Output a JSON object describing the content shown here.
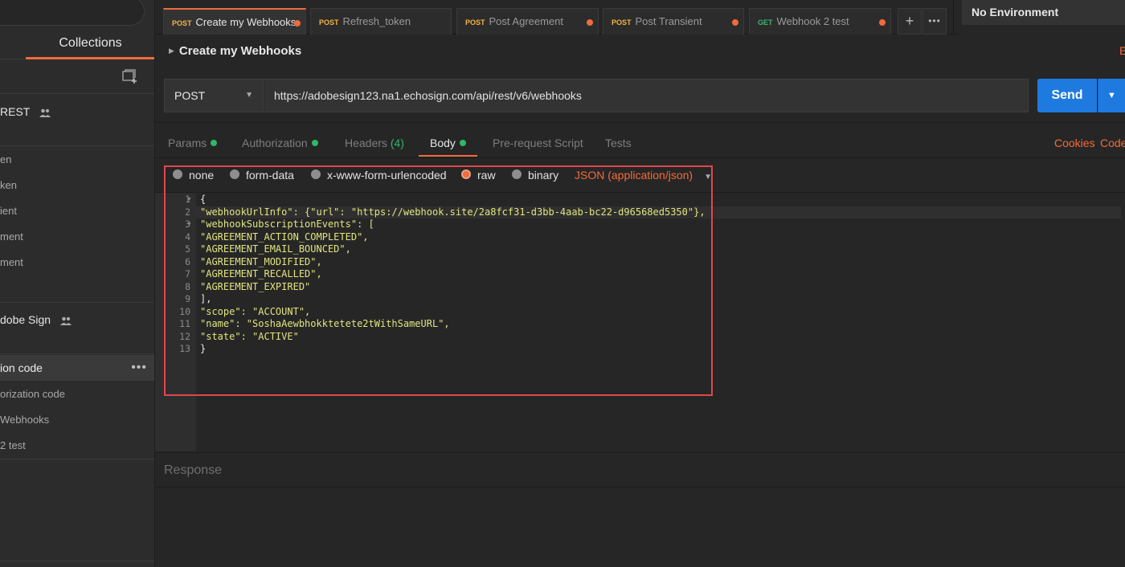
{
  "sidebar": {
    "tab_label": "Collections",
    "collections": [
      {
        "name": "REST"
      },
      {
        "name": "dobe Sign"
      }
    ],
    "items_group1": [
      "en",
      "ken",
      "ient",
      "ment",
      "ment"
    ],
    "items_group2": [
      {
        "label": "ion code",
        "active": true
      },
      {
        "label": "orization code",
        "active": false
      },
      {
        "label": "Webhooks",
        "active": false
      },
      {
        "label": "2 test",
        "active": false
      }
    ],
    "more_label": "•••"
  },
  "tabs": [
    {
      "method": "POST",
      "name": "Create my Webhooks",
      "active": true
    },
    {
      "method": "POST",
      "name": "Refresh_token",
      "active": false
    },
    {
      "method": "POST",
      "name": "Post Agreement",
      "active": false
    },
    {
      "method": "POST",
      "name": "Post Transient",
      "active": false
    },
    {
      "method": "GET",
      "name": "Webhook 2 test",
      "active": false
    }
  ],
  "tab_controls": {
    "add": "+",
    "more": "•••"
  },
  "environment": "No Environment",
  "request": {
    "name": "Create my Webhooks",
    "method": "POST",
    "url": "https://adobesign123.na1.echosign.com/api/rest/v6/webhooks",
    "send_label": "Send",
    "edge_label": "E"
  },
  "request_tabs": {
    "params": "Params",
    "authorization": "Authorization",
    "headers": "Headers",
    "headers_count": "(4)",
    "body": "Body",
    "prerequest": "Pre-request Script",
    "tests": "Tests"
  },
  "right_links": {
    "cookies": "Cookies",
    "code": "Code"
  },
  "body_types": {
    "none": "none",
    "form_data": "form-data",
    "urlencoded": "x-www-form-urlencoded",
    "raw": "raw",
    "binary": "binary",
    "selected": "raw",
    "content_type": "JSON (application/json)"
  },
  "code_lines": [
    "{",
    "\"webhookUrlInfo\": {\"url\": \"https://webhook.site/2a8fcf31-d3bb-4aab-bc22-d96568ed5350\"},",
    "\"webhookSubscriptionEvents\": [",
    "\"AGREEMENT_ACTION_COMPLETED\",",
    "\"AGREEMENT_EMAIL_BOUNCED\",",
    "\"AGREEMENT_MODIFIED\",",
    "\"AGREEMENT_RECALLED\",",
    "\"AGREEMENT_EXPIRED\"",
    "],",
    "\"scope\": \"ACCOUNT\",",
    "\"name\": \"SoshaAewbhokktetete2tWithSameURL\",",
    "\"state\": \"ACTIVE\"",
    "}"
  ],
  "line_numbers": [
    "1",
    "2",
    "3",
    "4",
    "5",
    "6",
    "7",
    "8",
    "9",
    "10",
    "11",
    "12",
    "13"
  ],
  "response_label": "Response",
  "colors": {
    "accent": "#f26b3a",
    "send_button": "#1f7ae0",
    "status_dot": "#2fb76b",
    "highlight_box": "#e0474c",
    "json_token": "#e2e47e"
  }
}
